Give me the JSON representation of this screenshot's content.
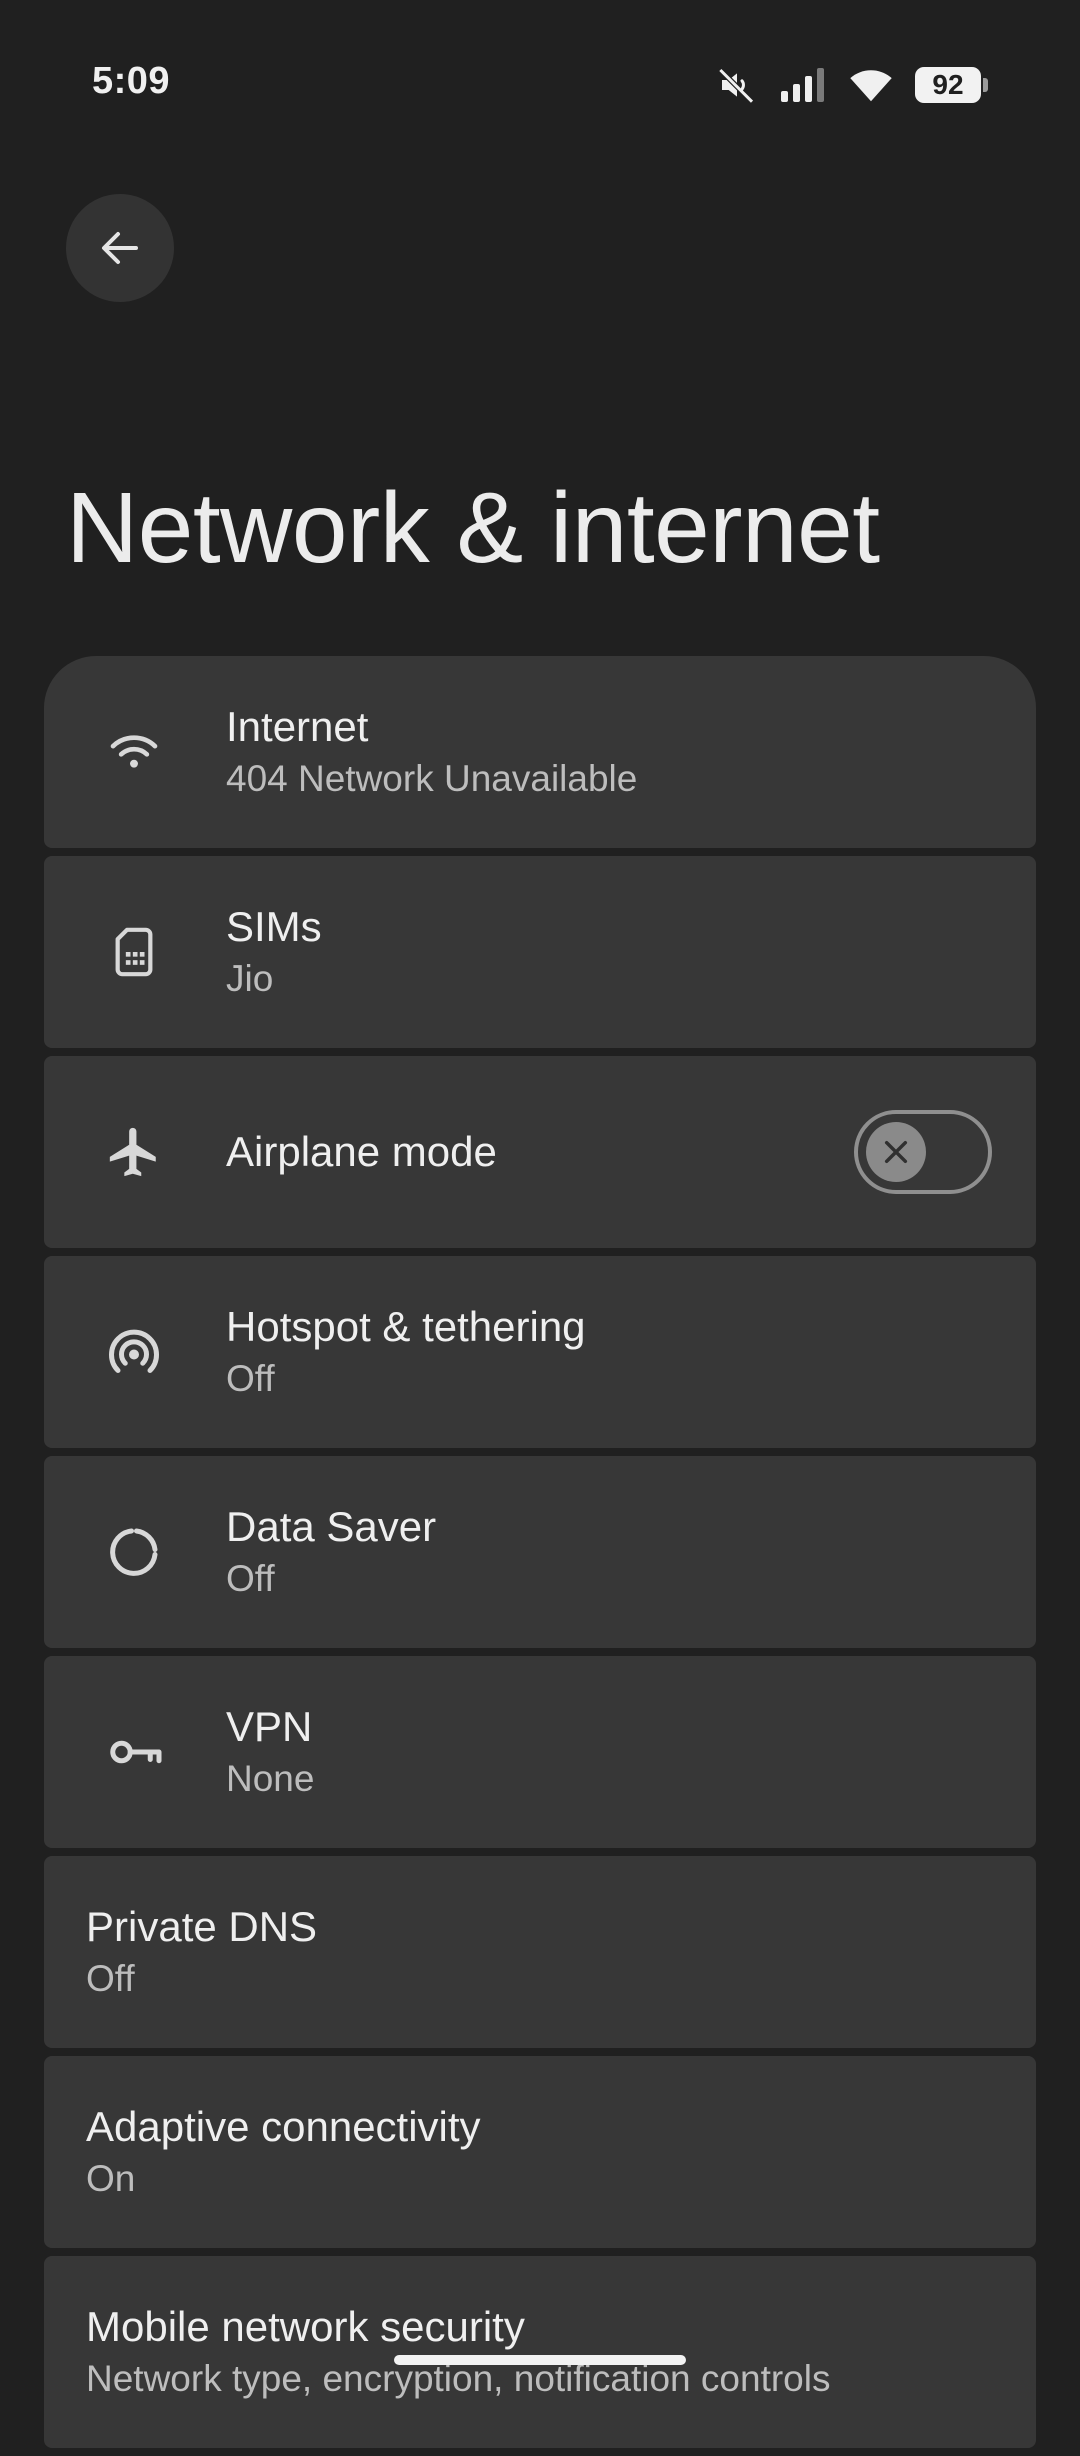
{
  "status_bar": {
    "time": "5:09",
    "battery": "92",
    "icons": [
      "mute-icon",
      "signal-icon",
      "wifi-icon",
      "battery-icon"
    ]
  },
  "header": {
    "back_icon": "arrow-back-icon",
    "title": "Network & internet"
  },
  "items": [
    {
      "icon": "wifi-icon",
      "title": "Internet",
      "subtitle": "404 Network Unavailable"
    },
    {
      "icon": "sim-card-icon",
      "title": "SIMs",
      "subtitle": "Jio"
    },
    {
      "icon": "airplane-icon",
      "title": "Airplane mode",
      "toggle": false
    },
    {
      "icon": "hotspot-icon",
      "title": "Hotspot & tethering",
      "subtitle": "Off"
    },
    {
      "icon": "data-saver-icon",
      "title": "Data Saver",
      "subtitle": "Off"
    },
    {
      "icon": "vpn-key-icon",
      "title": "VPN",
      "subtitle": "None"
    },
    {
      "title": "Private DNS",
      "subtitle": "Off"
    },
    {
      "title": "Adaptive connectivity",
      "subtitle": "On"
    },
    {
      "title": "Mobile network security",
      "subtitle": "Network type, encryption, notification controls"
    }
  ],
  "colors": {
    "background": "#202020",
    "card": "#373737",
    "primary_text": "#efefef",
    "secondary_text": "#bdbdbd"
  }
}
